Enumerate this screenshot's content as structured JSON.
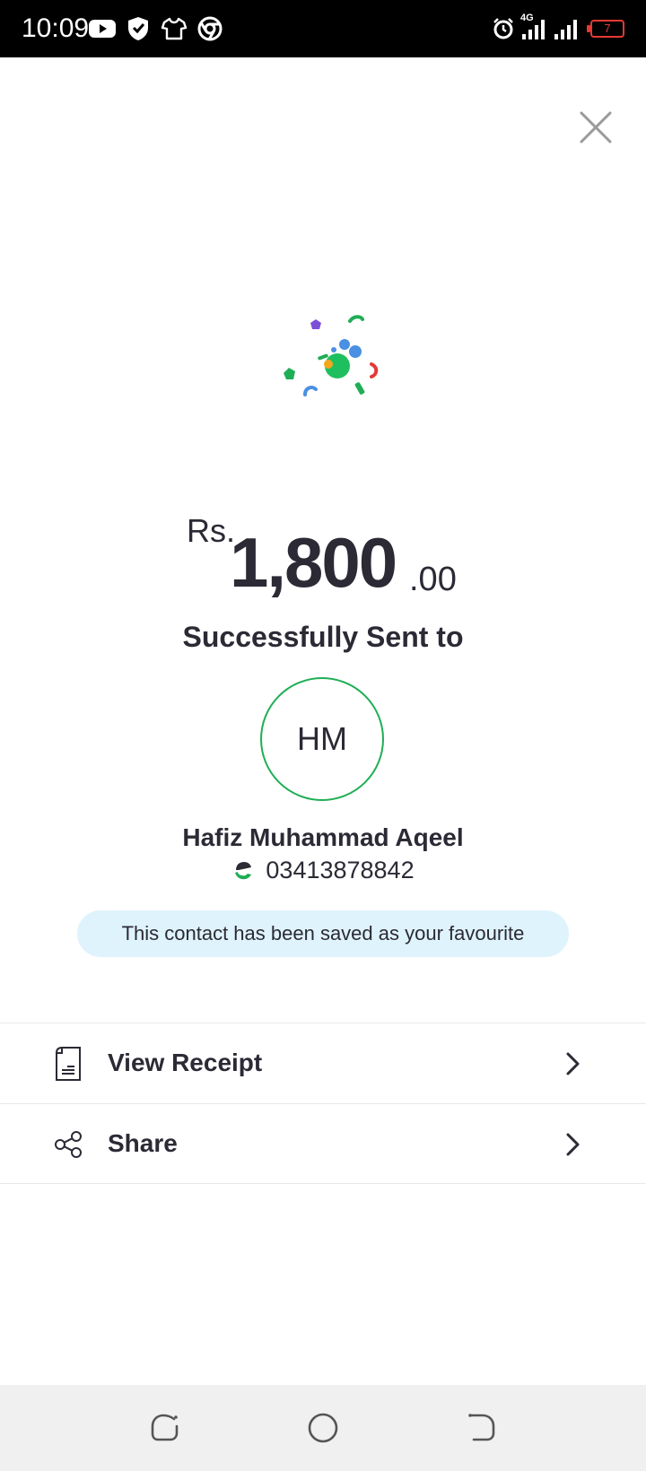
{
  "status_bar": {
    "time": "10:09",
    "network": "4G",
    "battery": "7",
    "left_icons": [
      "youtube-icon",
      "shield-icon",
      "tshirt-icon",
      "chrome-icon"
    ],
    "right_icons": [
      "alarm-icon",
      "signal-4g-icon",
      "signal-icon",
      "battery-icon"
    ]
  },
  "header": {
    "close_icon": "close-icon"
  },
  "transaction": {
    "currency": "Rs.",
    "amount_main": "1,800",
    "amount_decimal": ".00",
    "status_text": "Successfully Sent to"
  },
  "recipient": {
    "initials": "HM",
    "name": "Hafiz Muhammad Aqeel",
    "phone": "03413878842",
    "wallet_icon": "easypaisa-icon"
  },
  "favourite_banner": "This contact has been saved as your favourite",
  "actions": [
    {
      "label": "View Receipt",
      "icon": "receipt-icon"
    },
    {
      "label": "Share",
      "icon": "share-icon"
    }
  ],
  "colors": {
    "accent_green": "#1fae55",
    "banner_bg": "#dff3fc",
    "text_primary": "#2b2a35",
    "battery_red": "#e53935"
  },
  "nav_bar": {
    "buttons": [
      "recents-icon",
      "home-icon",
      "back-icon"
    ]
  }
}
